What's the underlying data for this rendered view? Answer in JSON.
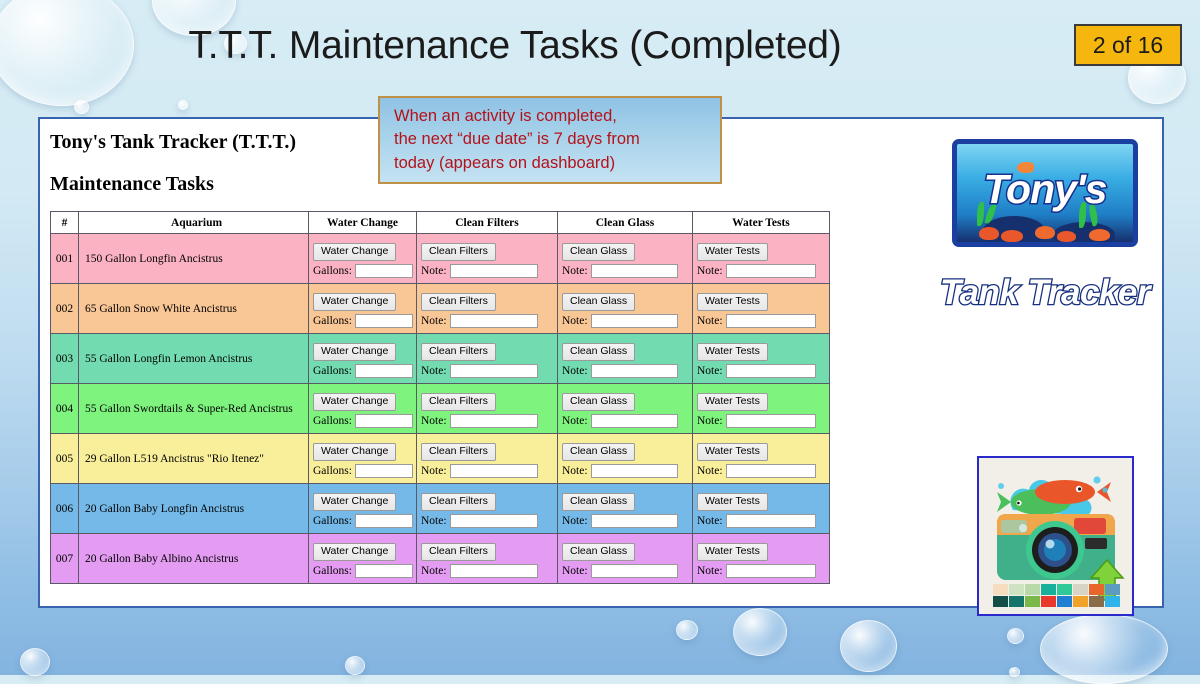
{
  "slide": {
    "title": "T.T.T. Maintenance Tasks (Completed)",
    "page_indicator": "2 of 16",
    "badge_color": "#f5b70d",
    "background_color": "#bfdcf0",
    "panel_border_color": "#3763af"
  },
  "panel": {
    "title": "Tony's Tank Tracker (T.T.T.)",
    "subtitle": "Maintenance Tasks"
  },
  "callout": {
    "line1": "When an activity is completed,",
    "line2": "the next “due date” is 7 days from",
    "line3": "today (appears on dashboard)",
    "text_color": "#b4121b",
    "border_color": "#bf9045"
  },
  "table": {
    "headers": [
      "#",
      "Aquarium",
      "Water Change",
      "Clean Filters",
      "Clean Glass",
      "Water Tests"
    ],
    "water_change_label": "Gallons:",
    "note_label": "Note:",
    "rows": [
      {
        "num": "001",
        "aquarium": "150 Gallon Longfin Ancistrus",
        "color": "#fbb3c4"
      },
      {
        "num": "002",
        "aquarium": "65 Gallon Snow White Ancistrus",
        "color": "#f9c695"
      },
      {
        "num": "003",
        "aquarium": "55 Gallon Longfin Lemon Ancistrus",
        "color": "#72dcb0"
      },
      {
        "num": "004",
        "aquarium": "55 Gallon Swordtails & Super-Red Ancistrus",
        "color": "#7ef37e"
      },
      {
        "num": "005",
        "aquarium": "29 Gallon L519 Ancistrus \"Rio Itenez\"",
        "color": "#f9ef9a"
      },
      {
        "num": "006",
        "aquarium": "20 Gallon Baby Longfin Ancistrus",
        "color": "#74b9e8"
      },
      {
        "num": "007",
        "aquarium": "20 Gallon Baby Albino Ancistrus",
        "color": "#e39cf2"
      }
    ],
    "buttons": {
      "water_change": "Water Change",
      "clean_filters": "Clean Filters",
      "clean_glass": "Clean Glass",
      "water_tests": "Water Tests"
    },
    "input_value": ""
  },
  "logo": {
    "tank_word": "Tony's",
    "caption": "Tank Tracker"
  }
}
